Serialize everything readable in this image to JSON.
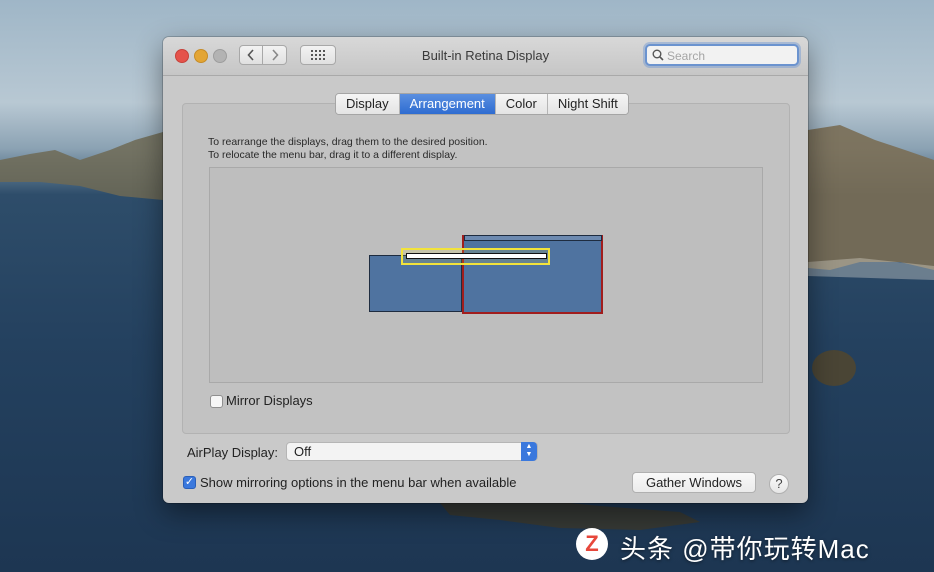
{
  "window": {
    "title": "Built-in Retina Display",
    "search_placeholder": "Search"
  },
  "toolbar": {
    "back_icon": "chevron-left-icon",
    "forward_icon": "chevron-right-icon",
    "show_all_icon": "grid-icon"
  },
  "tabs": [
    {
      "label": "Display",
      "active": false
    },
    {
      "label": "Arrangement",
      "active": true
    },
    {
      "label": "Color",
      "active": false
    },
    {
      "label": "Night Shift",
      "active": false
    }
  ],
  "arrangement": {
    "instruction_line1": "To rearrange the displays, drag them to the desired position.",
    "instruction_line2": "To relocate the menu bar, drag it to a different display.",
    "mirror_label": "Mirror Displays",
    "mirror_checked": false
  },
  "airplay": {
    "label": "AirPlay Display:",
    "value": "Off"
  },
  "mirroring_option": {
    "label": "Show mirroring options in the menu bar when available",
    "checked": true
  },
  "buttons": {
    "gather_windows": "Gather Windows",
    "help": "?"
  },
  "watermark": {
    "text": "头条 @带你玩转Mac",
    "logo_glyph": "Z"
  },
  "colors": {
    "accent": "#3a78dd",
    "display_fill": "#4f73a0",
    "main_display_border": "#a11d1d",
    "menubar_highlight": "#f2e33b"
  }
}
